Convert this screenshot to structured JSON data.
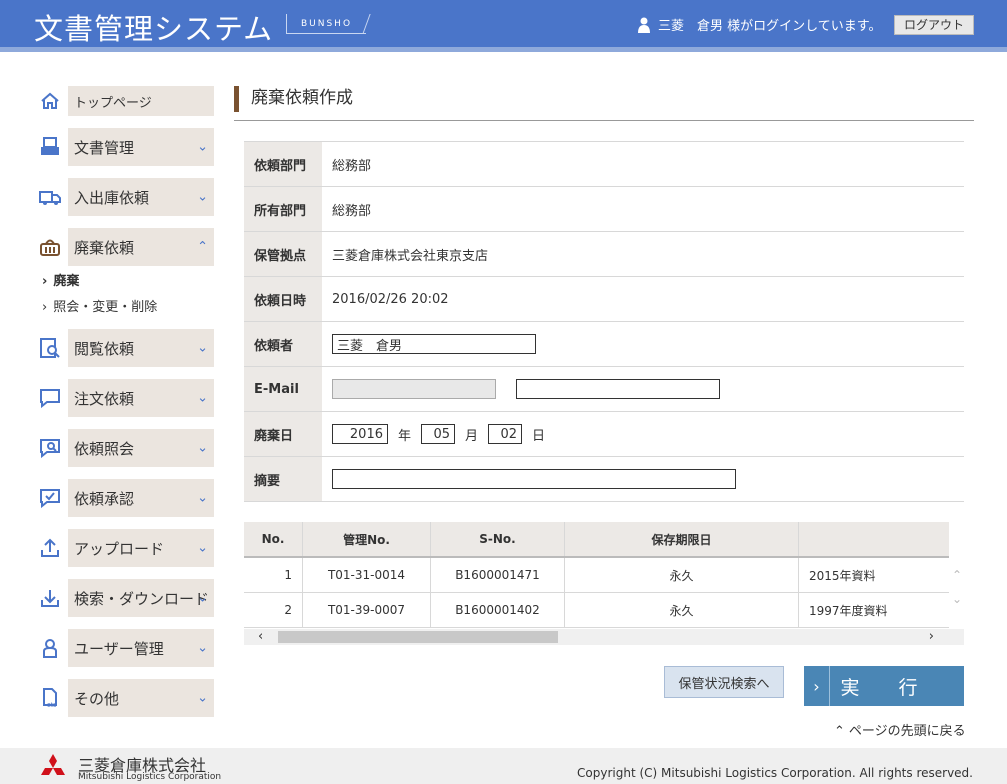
{
  "header": {
    "app_title": "文書管理システム",
    "badge": "BUNSHO",
    "user_text": "三菱　倉男 様がログインしています。",
    "logout_label": "ログアウト"
  },
  "sidebar": {
    "items": [
      {
        "label": "トップページ",
        "icon": "home-icon"
      },
      {
        "label": "文書管理",
        "icon": "document-icon"
      },
      {
        "label": "入出庫依頼",
        "icon": "truck-icon"
      },
      {
        "label": "廃棄依頼",
        "icon": "basket-icon"
      },
      {
        "label": "閲覧依頼",
        "icon": "magnify-doc-icon"
      },
      {
        "label": "注文依頼",
        "icon": "speech-bubble-icon"
      },
      {
        "label": "依頼照会",
        "icon": "search-bubble-icon"
      },
      {
        "label": "依頼承認",
        "icon": "check-bubble-icon"
      },
      {
        "label": "アップロード",
        "icon": "upload-icon"
      },
      {
        "label": "検索・ダウンロード",
        "icon": "download-icon"
      },
      {
        "label": "ユーザー管理",
        "icon": "user-icon"
      },
      {
        "label": "その他",
        "icon": "etc-icon"
      }
    ],
    "sub_items": [
      "廃棄",
      "照会・変更・削除"
    ]
  },
  "main": {
    "page_title": "廃棄依頼作成",
    "form": {
      "dept_label": "依頼部門",
      "dept_value": "総務部",
      "owner_label": "所有部門",
      "owner_value": "総務部",
      "base_label": "保管拠点",
      "base_value": "三菱倉庫株式会社東京支店",
      "date_label": "依頼日時",
      "date_value": "2016/02/26 20:02",
      "requester_label": "依頼者",
      "requester_value": "三菱　倉男",
      "email_label": "E-Mail",
      "email_value1": "",
      "email_value2": "",
      "disposal_label": "廃棄日",
      "year": "2016",
      "year_unit": "年",
      "month": "05",
      "month_unit": "月",
      "day": "02",
      "day_unit": "日",
      "summary_label": "摘要",
      "summary_value": ""
    },
    "table": {
      "headers": [
        "No.",
        "管理No.",
        "S-No.",
        "保存期限日",
        ""
      ],
      "rows": [
        [
          "1",
          "T01-31-0014",
          "B1600001471",
          "永久",
          "2015年資料"
        ],
        [
          "2",
          "T01-39-0007",
          "B1600001402",
          "永久",
          "1997年度資料"
        ]
      ]
    },
    "search_button": "保管状況検索へ",
    "execute_button": "実　行",
    "back_to_top": "ページの先頭に戻る"
  },
  "footer": {
    "company": "三菱倉庫株式会社",
    "company_en": "Mitsubishi Logistics Corporation",
    "copyright": "Copyright (C) Mitsubishi Logistics Corporation. All rights reserved."
  }
}
